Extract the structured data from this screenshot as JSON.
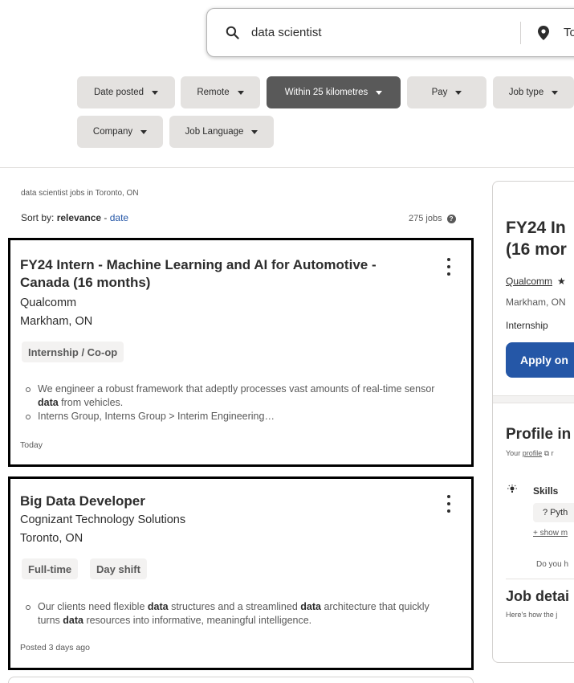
{
  "search": {
    "what_value": "data scientist",
    "where_value_partial": "To"
  },
  "filters": [
    {
      "label": "Date posted",
      "active": false
    },
    {
      "label": "Remote",
      "active": false
    },
    {
      "label": "Within 25 kilometres",
      "active": true
    },
    {
      "label": "Pay",
      "active": false
    },
    {
      "label": "Job type",
      "active": false
    },
    {
      "label": "Company",
      "active": false
    },
    {
      "label": "Job Language",
      "active": false
    }
  ],
  "results": {
    "breadcrumb": "data scientist jobs in Toronto, ON",
    "sort_prefix": "Sort by: ",
    "sort_active": "relevance",
    "sort_sep": " - ",
    "sort_other": "date",
    "count": "275 jobs"
  },
  "jobs": [
    {
      "title": "FY24 Intern - Machine Learning and AI for Automotive - Canada (16 months)",
      "company": "Qualcomm",
      "location": "Markham, ON",
      "tags": [
        "Internship / Co-op"
      ],
      "snippet": [
        [
          "We engineer a robust framework that adeptly processes vast amounts of real-time sensor ",
          "data",
          " from vehicles."
        ],
        [
          "Interns Group, Interns Group > Interim Engineering…"
        ]
      ],
      "posted": "Today"
    },
    {
      "title": "Big Data Developer",
      "company": "Cognizant Technology Solutions",
      "location": "Toronto, ON",
      "tags": [
        "Full-time",
        "Day shift"
      ],
      "snippet": [
        [
          "Our clients need flexible ",
          "data",
          " structures and a streamlined ",
          "data",
          " architecture that quickly turns ",
          "data",
          " resources into informative, meaningful intelligence."
        ]
      ],
      "posted": "Posted 3 days ago"
    }
  ],
  "detail_panel": {
    "title_line1": "FY24 In",
    "title_line2": "(16 mor",
    "company": "Qualcomm",
    "location": "Markham, ON",
    "job_type": "Internship",
    "apply_label": "Apply on",
    "profile_heading": "Profile in",
    "profile_sub_prefix": "Your ",
    "profile_sub_link": "profile",
    "profile_sub_suffix": " r",
    "skills_label": "Skills",
    "skill_chip": "? Pyth",
    "show_more": "+ show m",
    "do_you": "Do you h",
    "job_details_heading": "Job detai",
    "job_details_sub": "Here's how the j"
  },
  "colors": {
    "accent": "#2557a7",
    "active_filter": "#595959",
    "pill_bg": "#e4e2e0",
    "text": "#2d2d2d",
    "muted": "#595959"
  },
  "icons": {
    "search": "search-icon",
    "location": "location-pin-icon",
    "help": "help-circle-icon",
    "more": "kebab-menu-icon",
    "star": "star-icon",
    "external": "external-link-icon",
    "skills": "lightbulb-icon"
  }
}
